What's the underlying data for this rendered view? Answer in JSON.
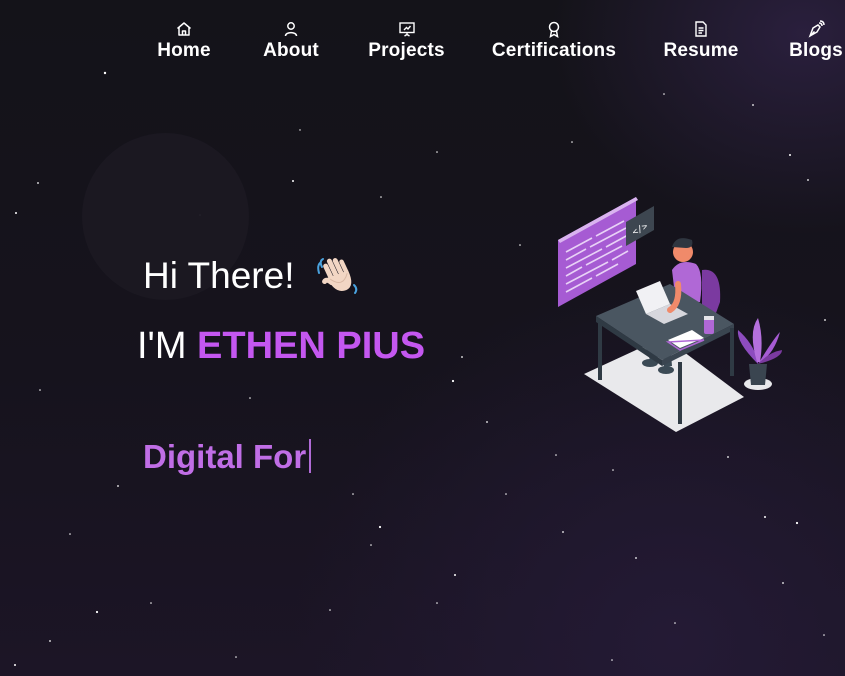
{
  "nav": {
    "items": [
      {
        "label": "Home",
        "icon": "home-icon"
      },
      {
        "label": "About",
        "icon": "user-icon"
      },
      {
        "label": "Projects",
        "icon": "presentation-icon"
      },
      {
        "label": "Certifications",
        "icon": "award-icon"
      },
      {
        "label": "Resume",
        "icon": "document-icon"
      },
      {
        "label": "Blogs",
        "icon": "pen-nib-icon"
      }
    ]
  },
  "hero": {
    "greeting": "Hi There!",
    "greeting_emoji": "waving-hand-icon",
    "intro_prefix": "I'M",
    "name": "ETHEN PIUS",
    "typed_text": "Digital For"
  },
  "colors": {
    "accent": "#c457f0",
    "typed": "#c06ee6",
    "background": "#141319"
  }
}
